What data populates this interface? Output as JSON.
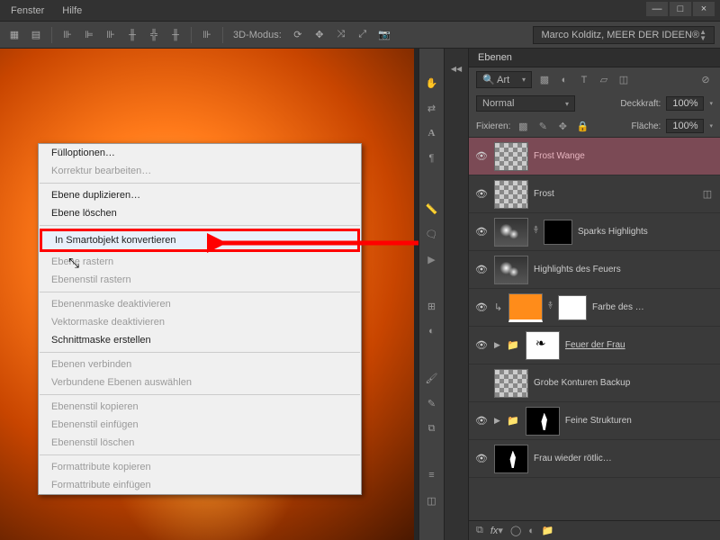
{
  "menubar": {
    "fenster": "Fenster",
    "hilfe": "Hilfe"
  },
  "toolbar": {
    "mode_label": "3D-Modus:",
    "user": "Marco Kolditz, MEER DER IDEEN®"
  },
  "window_controls": {
    "min": "—",
    "max": "□",
    "close": "×"
  },
  "context_menu": {
    "fuelloptionen": "Fülloptionen…",
    "korrektur": "Korrektur bearbeiten…",
    "duplizieren": "Ebene duplizieren…",
    "loeschen": "Ebene löschen",
    "smart": "In Smartobjekt konvertieren",
    "rastern": "Ebene rastern",
    "stil_rastern": "Ebenenstil rastern",
    "maske_deakt": "Ebenenmaske deaktivieren",
    "vektor_deakt": "Vektormaske deaktivieren",
    "schnitt": "Schnittmaske erstellen",
    "verbinden": "Ebenen verbinden",
    "verbunden_ausw": "Verbundene Ebenen auswählen",
    "stil_kopieren": "Ebenenstil kopieren",
    "stil_einfuegen": "Ebenenstil einfügen",
    "stil_loeschen": "Ebenenstil löschen",
    "format_kopieren": "Formattribute kopieren",
    "format_einfuegen": "Formattribute einfügen"
  },
  "panel": {
    "tab": "Ebenen",
    "filter_label": "Art",
    "blend": "Normal",
    "deck_label": "Deckkraft:",
    "deck_val": "100%",
    "fix_label": "Fixieren:",
    "flaeche_label": "Fläche:",
    "flaeche_val": "100%",
    "layers": [
      {
        "name": "Frost Wange",
        "selected": true,
        "thumb": "checker"
      },
      {
        "name": "Frost",
        "thumb": "checker",
        "badge": true
      },
      {
        "name": "Sparks Highlights",
        "thumb": "spark",
        "mask": "black",
        "link": true
      },
      {
        "name": "Highlights des Feuers",
        "thumb": "spark"
      },
      {
        "name": "Farbe des …",
        "thumb": "orange",
        "mask": "white",
        "link": true,
        "indent": true
      },
      {
        "name": "Feuer der Frau",
        "thumb": "white-figure",
        "folder": true,
        "underline": true
      },
      {
        "name": "Grobe Konturen Backup",
        "thumb": "checker"
      },
      {
        "name": "Feine Strukturen",
        "thumb": "flame",
        "folder": true
      },
      {
        "name": "Frau wieder rötlic…",
        "thumb": "flame"
      }
    ]
  }
}
